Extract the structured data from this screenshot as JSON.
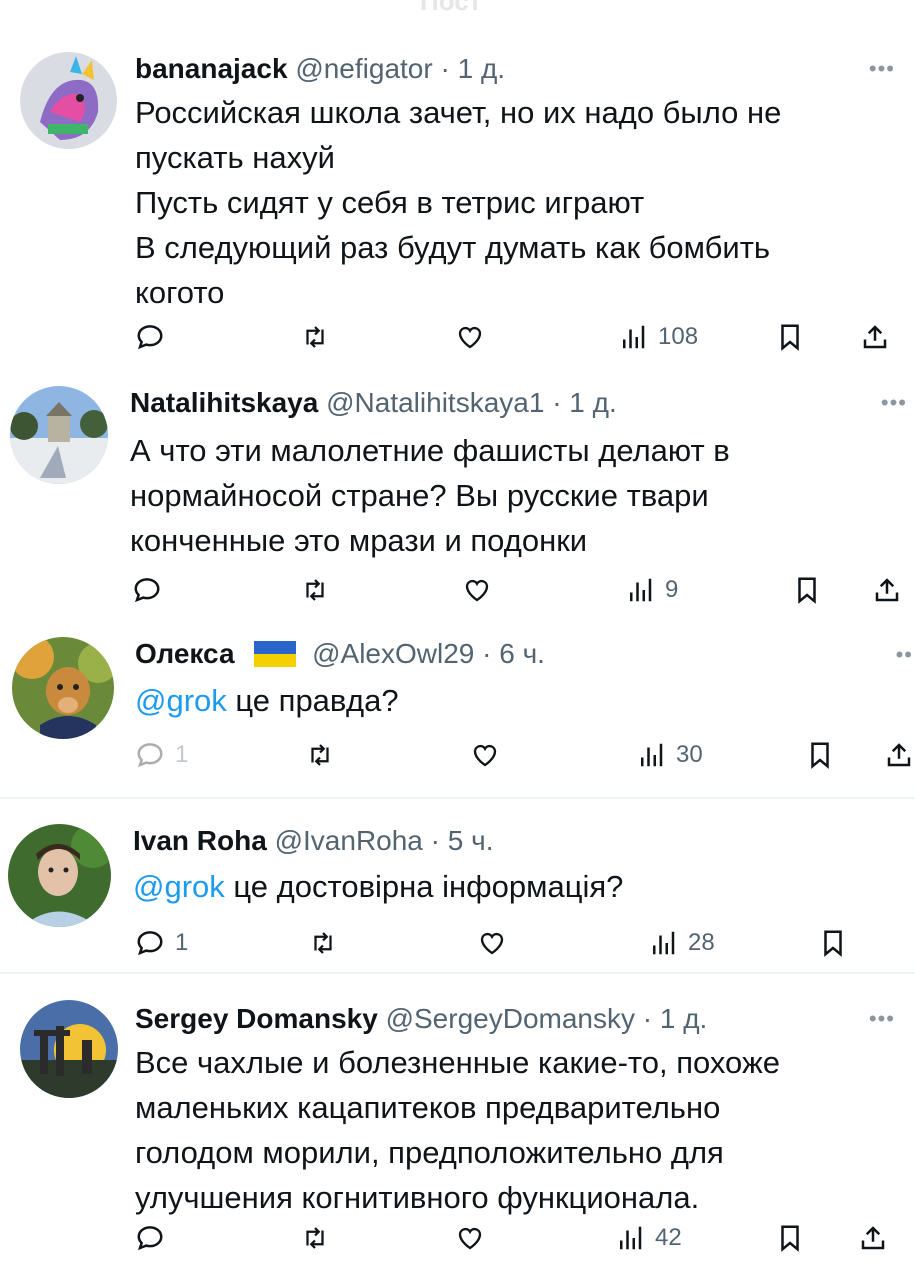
{
  "header": {
    "title": "Пост"
  },
  "tweets": [
    {
      "name": "bananajack",
      "handle": "@nefigator",
      "time": "· 1 д.",
      "lines": [
        "Российская школа зачет, но их надо было не",
        "пускать нахуй",
        "Пусть сидят у себя в тетрис играют",
        "В следующий раз будут думать как бомбить",
        "когото"
      ],
      "replies": "",
      "views": "108"
    },
    {
      "name": "Natalihitskaya",
      "handle": "@Natalihitskaya1",
      "time": "· 1 д.",
      "lines": [
        "А что эти малолетние фашисты делают в",
        "нормайносой стране? Вы русские твари",
        "конченные это мрази и подонки"
      ],
      "replies": "",
      "views": "9"
    },
    {
      "name": "Олекса",
      "handle": "@AlexOwl29",
      "time": "· 6 ч.",
      "mention": "@grok",
      "text": " це правда?",
      "replies": "1",
      "views": "30"
    },
    {
      "name": "Ivan Roha",
      "handle": "@IvanRoha",
      "time": "· 5 ч.",
      "mention": "@grok",
      "text": " це достовірна інформація?",
      "replies": "1",
      "views": "28"
    },
    {
      "name": "Sergey Domansky",
      "handle": "@SergeyDomansky",
      "time": "· 1 д.",
      "lines": [
        "Все чахлые и болезненные какие-то, похоже",
        "маленьких кацапитеков предварительно",
        "голодом морили, предположительно для",
        "улучшения когнитивного функционала."
      ],
      "replies": "",
      "views": "42"
    }
  ],
  "icons": {
    "reply": "reply-icon",
    "retweet": "retweet-icon",
    "like": "like-icon",
    "views": "views-icon",
    "bookmark": "bookmark-icon",
    "share": "share-icon",
    "more": "more-icon"
  },
  "colors": {
    "text": "#0f1419",
    "secondary": "#536471",
    "link": "#1d9bf0",
    "divider": "#eff3f4"
  }
}
